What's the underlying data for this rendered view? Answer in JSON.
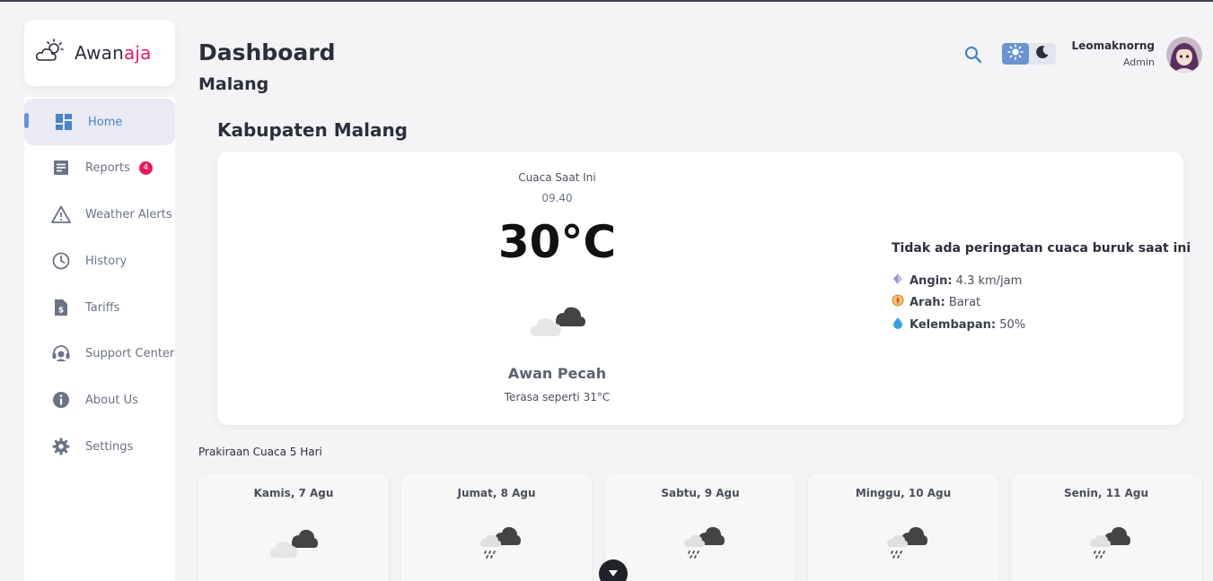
{
  "brand": {
    "name_main": "Awan",
    "name_accent": "aja"
  },
  "sidebar": {
    "items": [
      {
        "label": "Home",
        "icon": "dashboard-icon",
        "active": true
      },
      {
        "label": "Reports",
        "icon": "report-icon",
        "badge": "4"
      },
      {
        "label": "Weather Alerts",
        "icon": "warning-icon"
      },
      {
        "label": "History",
        "icon": "clock-icon"
      },
      {
        "label": "Tariffs",
        "icon": "tariff-document-icon"
      },
      {
        "label": "Support Center",
        "icon": "support-headset-icon"
      },
      {
        "label": "About Us",
        "icon": "info-icon"
      },
      {
        "label": "Settings",
        "icon": "gear-icon"
      }
    ]
  },
  "header": {
    "title": "Dashboard",
    "subtitle": "Malang",
    "user": {
      "name": "Leomaknorng",
      "role": "Admin"
    },
    "theme": "light"
  },
  "current": {
    "region": "Kabupaten Malang",
    "label": "Cuaca Saat Ini",
    "time": "09.40",
    "temperature": "30°C",
    "condition": "Awan Pecah",
    "feels_like": "Terasa seperti 31°C",
    "alert": "Tidak ada peringatan cuaca buruk saat ini",
    "wind_label": "Angin:",
    "wind_value": "4.3 km/jam",
    "direction_label": "Arah:",
    "direction_value": "Barat",
    "humidity_label": "Kelembapan:",
    "humidity_value": "50%"
  },
  "forecast": {
    "title": "Prakiraan Cuaca 5 Hari",
    "days": [
      {
        "day": "Kamis, 7 Agu",
        "icon": "broken-clouds-icon"
      },
      {
        "day": "Jumat, 8 Agu",
        "icon": "rain-icon"
      },
      {
        "day": "Sabtu, 9 Agu",
        "icon": "rain-icon"
      },
      {
        "day": "Minggu, 10 Agu",
        "icon": "rain-icon"
      },
      {
        "day": "Senin, 11 Agu",
        "icon": "rain-icon"
      }
    ]
  },
  "colors": {
    "accent": "#e6195f",
    "primary": "#4a83c8",
    "background": "#f4f4f6"
  }
}
